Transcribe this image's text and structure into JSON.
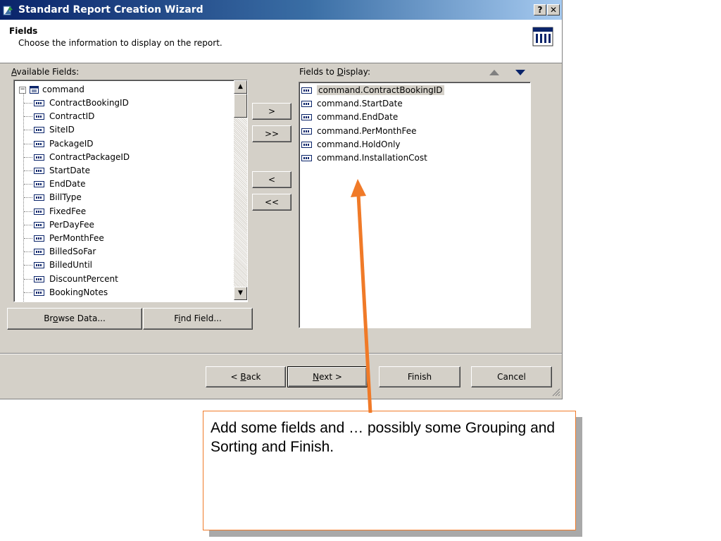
{
  "window": {
    "title": "Standard Report Creation Wizard",
    "help_label": "?",
    "close_label": "✕"
  },
  "header": {
    "title": "Fields",
    "subtitle": "Choose the information to display on the report."
  },
  "available": {
    "label_prefix": "",
    "label_u": "A",
    "label_rest": "vailable Fields:",
    "root": "command",
    "items": [
      "ContractBookingID",
      "ContractID",
      "SiteID",
      "PackageID",
      "ContractPackageID",
      "StartDate",
      "EndDate",
      "BillType",
      "FixedFee",
      "PerDayFee",
      "PerMonthFee",
      "BilledSoFar",
      "BilledUntil",
      "DiscountPercent",
      "BookingNotes"
    ]
  },
  "display": {
    "label_prefix": "Fields to ",
    "label_u": "D",
    "label_rest": "isplay:",
    "items": [
      "command.ContractBookingID",
      "command.StartDate",
      "command.EndDate",
      "command.PerMonthFee",
      "command.HoldOnly",
      "command.InstallationCost"
    ],
    "selected_index": 0
  },
  "move_buttons": {
    "add": ">",
    "add_all": ">>",
    "remove": "<",
    "remove_all": "<<"
  },
  "left_buttons": {
    "browse_pre": "Br",
    "browse_u": "o",
    "browse_post": "wse Data...",
    "find_pre": "F",
    "find_u": "i",
    "find_post": "nd Field..."
  },
  "footer": {
    "back_pre": "< ",
    "back_u": "B",
    "back_post": "ack",
    "next_u": "N",
    "next_post": "ext >",
    "finish": "Finish",
    "cancel": "Cancel"
  },
  "callout": {
    "text": "Add some fields and … possibly some Grouping and Sorting and Finish."
  },
  "colors": {
    "arrow": "#f07a28",
    "title_gradient_start": "#0a246a",
    "sort_down_arrow": "#0a246a"
  }
}
